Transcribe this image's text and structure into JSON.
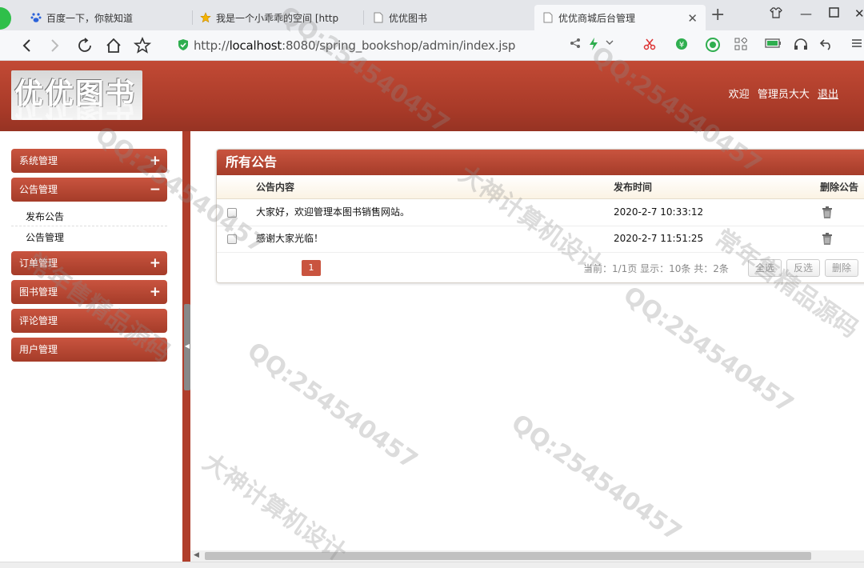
{
  "browser": {
    "tabs": [
      {
        "title": "百度一下，你就知道",
        "icon": "baidu-paw-icon"
      },
      {
        "title": "我是一个小乖乖的空间 [http",
        "icon": "star-icon"
      },
      {
        "title": "优优图书",
        "icon": "page-icon"
      },
      {
        "title": "优优商城后台管理",
        "icon": "page-icon"
      }
    ],
    "active_tab_index": 3,
    "url_prefix": "http://",
    "url_host": "localhost",
    "url_rest": ":8080/spring_bookshop/admin/index.jsp"
  },
  "header": {
    "logo_text": "优优图书",
    "welcome": "欢迎",
    "username": "管理员大大",
    "logout": "退出"
  },
  "sidebar": {
    "menus": [
      {
        "label": "系统管理",
        "toggle": "+"
      },
      {
        "label": "公告管理",
        "toggle": "−"
      },
      {
        "label": "订单管理",
        "toggle": "+"
      },
      {
        "label": "图书管理",
        "toggle": "+"
      },
      {
        "label": "评论管理",
        "toggle": ""
      },
      {
        "label": "用户管理",
        "toggle": ""
      }
    ],
    "submenu": [
      "发布公告",
      "公告管理"
    ]
  },
  "panel": {
    "title": "所有公告",
    "columns": [
      "公告内容",
      "发布时间",
      "删除公告"
    ],
    "rows": [
      {
        "content": "大家好，欢迎管理本图书销售网站。",
        "time": "2020-2-7 10:33:12"
      },
      {
        "content": "感谢大家光临！",
        "time": "2020-2-7 11:51:25"
      }
    ],
    "pager": {
      "current_page": "1",
      "info": "当前：1/1页  显示：10条  共：2条",
      "select_all": "全选",
      "invert": "反选",
      "delete": "删除"
    }
  },
  "watermarks": [
    "QQ:254540457",
    "大神计算机设计",
    "常年售精品源码"
  ],
  "colors": {
    "brand": "#b2402c",
    "accent_light": "#c9543f"
  }
}
